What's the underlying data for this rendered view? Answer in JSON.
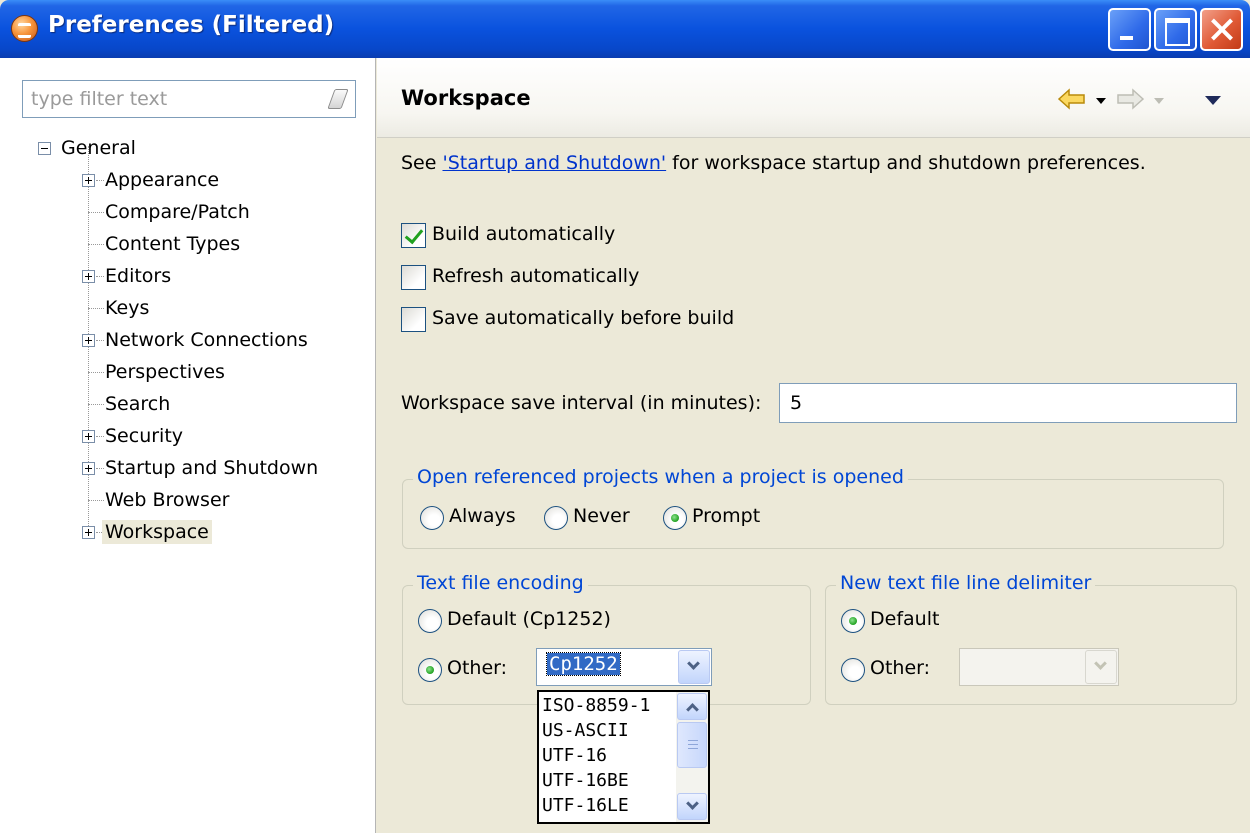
{
  "window": {
    "title": "Preferences (Filtered)"
  },
  "filter": {
    "placeholder": "type filter text"
  },
  "tree": {
    "root": "General",
    "items": [
      {
        "label": "Appearance",
        "expandable": true
      },
      {
        "label": "Compare/Patch",
        "expandable": false
      },
      {
        "label": "Content Types",
        "expandable": false
      },
      {
        "label": "Editors",
        "expandable": true
      },
      {
        "label": "Keys",
        "expandable": false
      },
      {
        "label": "Network Connections",
        "expandable": true
      },
      {
        "label": "Perspectives",
        "expandable": false
      },
      {
        "label": "Search",
        "expandable": false
      },
      {
        "label": "Security",
        "expandable": true
      },
      {
        "label": "Startup and Shutdown",
        "expandable": true
      },
      {
        "label": "Web Browser",
        "expandable": false
      },
      {
        "label": "Workspace",
        "expandable": true,
        "selected": true
      }
    ]
  },
  "page": {
    "title": "Workspace",
    "description_prefix": "See ",
    "description_link": "'Startup and Shutdown'",
    "description_suffix": " for workspace startup and shutdown preferences."
  },
  "options": {
    "build_auto": {
      "label": "Build automatically",
      "checked": true
    },
    "refresh_auto": {
      "label": "Refresh automatically",
      "checked": false
    },
    "save_before_build": {
      "label": "Save automatically before build",
      "checked": false
    }
  },
  "interval": {
    "label": "Workspace save interval (in minutes):",
    "value": "5"
  },
  "open_projects": {
    "title": "Open referenced projects when a project is opened",
    "always": "Always",
    "never": "Never",
    "prompt": "Prompt",
    "selected": "Prompt"
  },
  "encoding": {
    "title": "Text file encoding",
    "default_label": "Default (Cp1252)",
    "other_label": "Other:",
    "selected": "Other",
    "value": "Cp1252",
    "options": [
      "ISO-8859-1",
      "US-ASCII",
      "UTF-16",
      "UTF-16BE",
      "UTF-16LE"
    ]
  },
  "delimiter": {
    "title": "New text file line delimiter",
    "default_label": "Default",
    "other_label": "Other:",
    "selected": "Default",
    "value": ""
  },
  "colors": {
    "titlebar": "#0a52de",
    "group_title": "#0046d5",
    "link": "#0033cc",
    "selection": "#316ac5",
    "check": "#21a121"
  },
  "icons": {
    "app": "eclipse-icon",
    "filter_clear": "eraser-icon",
    "back": "back-arrow-icon",
    "forward": "forward-arrow-icon",
    "menu": "view-menu-icon"
  }
}
